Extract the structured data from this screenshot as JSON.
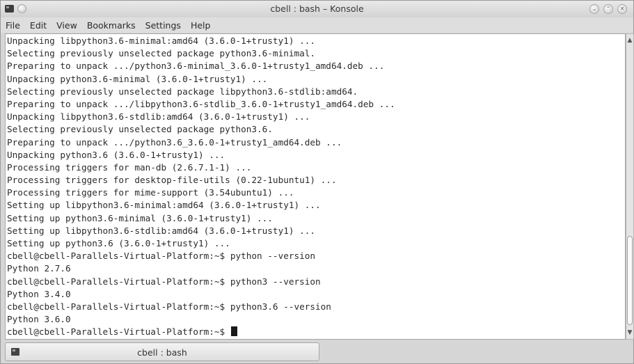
{
  "window": {
    "title": "cbell : bash – Konsole",
    "icons": [
      "terminal-app-icon",
      "pin-icon",
      "minimize-icon",
      "maximize-icon",
      "close-icon"
    ]
  },
  "menu": [
    "File",
    "Edit",
    "View",
    "Bookmarks",
    "Settings",
    "Help"
  ],
  "terminal": {
    "lines": [
      "Unpacking libpython3.6-minimal:amd64 (3.6.0-1+trusty1) ...",
      "Selecting previously unselected package python3.6-minimal.",
      "Preparing to unpack .../python3.6-minimal_3.6.0-1+trusty1_amd64.deb ...",
      "Unpacking python3.6-minimal (3.6.0-1+trusty1) ...",
      "Selecting previously unselected package libpython3.6-stdlib:amd64.",
      "Preparing to unpack .../libpython3.6-stdlib_3.6.0-1+trusty1_amd64.deb ...",
      "Unpacking libpython3.6-stdlib:amd64 (3.6.0-1+trusty1) ...",
      "Selecting previously unselected package python3.6.",
      "Preparing to unpack .../python3.6_3.6.0-1+trusty1_amd64.deb ...",
      "Unpacking python3.6 (3.6.0-1+trusty1) ...",
      "Processing triggers for man-db (2.6.7.1-1) ...",
      "Processing triggers for desktop-file-utils (0.22-1ubuntu1) ...",
      "Processing triggers for mime-support (3.54ubuntu1) ...",
      "Setting up libpython3.6-minimal:amd64 (3.6.0-1+trusty1) ...",
      "Setting up python3.6-minimal (3.6.0-1+trusty1) ...",
      "Setting up libpython3.6-stdlib:amd64 (3.6.0-1+trusty1) ...",
      "Setting up python3.6 (3.6.0-1+trusty1) ...",
      "cbell@cbell-Parallels-Virtual-Platform:~$ python --version",
      "Python 2.7.6",
      "cbell@cbell-Parallels-Virtual-Platform:~$ python3 --version",
      "Python 3.4.0",
      "cbell@cbell-Parallels-Virtual-Platform:~$ python3.6 --version",
      "Python 3.6.0"
    ],
    "prompt": "cbell@cbell-Parallels-Virtual-Platform:~$ "
  },
  "tabs": [
    {
      "label": "cbell : bash",
      "icon": "terminal-tab-icon"
    }
  ],
  "scrollbar": {
    "up": "▲",
    "down": "▼"
  }
}
